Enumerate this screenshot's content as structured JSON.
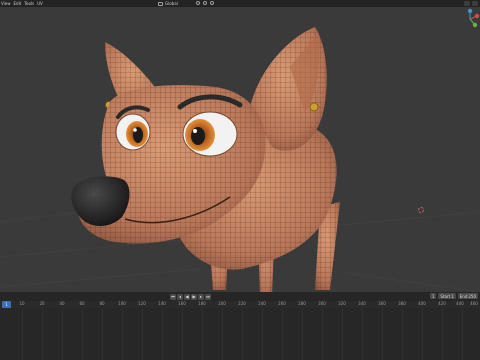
{
  "header": {
    "menu": [
      "View",
      "Edit",
      "Tools",
      "UV"
    ],
    "orientation_label": "Global"
  },
  "timeline": {
    "current_frame": "1",
    "start_label": "Start",
    "start_value": "1",
    "end_label": "End",
    "end_value": "250",
    "ruler_ticks": [
      "10",
      "20",
      "40",
      "60",
      "80",
      "100",
      "120",
      "140",
      "160",
      "180",
      "200",
      "220",
      "240",
      "260",
      "280",
      "300",
      "320",
      "340",
      "360",
      "380",
      "400",
      "420",
      "440",
      "460"
    ]
  },
  "icons": {
    "play": "play-icon",
    "rewind": "jump-start-icon",
    "forward": "jump-end-icon"
  },
  "colors": {
    "skin": "#c07e5a",
    "wire": "#3a1f14",
    "frame_cursor": "#3c6fb6",
    "viewport_bg": "#3a3a3a"
  }
}
